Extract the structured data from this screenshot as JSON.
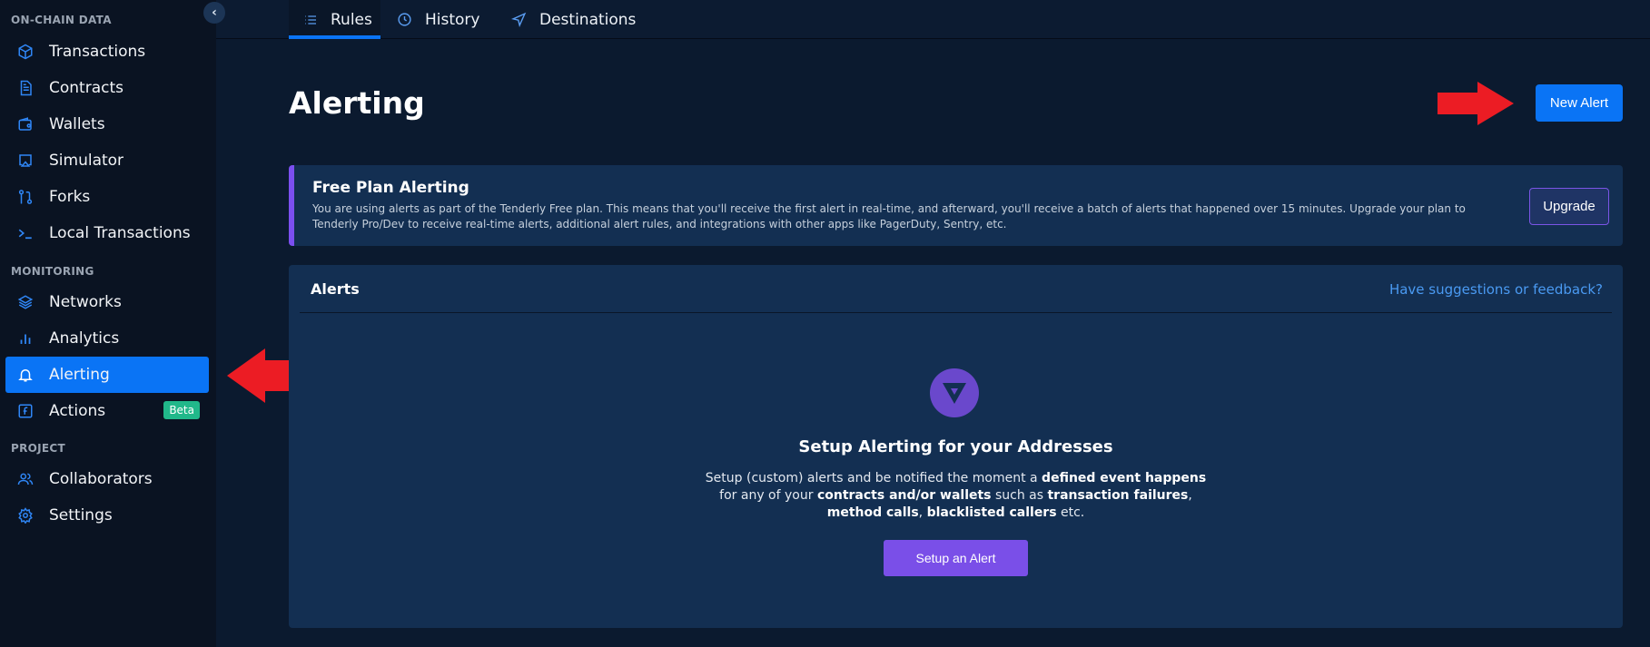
{
  "sidebar": {
    "collapse_icon": "chevron-left-icon",
    "sections": [
      {
        "label": "ON-CHAIN DATA",
        "items": [
          {
            "label": "Transactions",
            "icon": "cube-icon"
          },
          {
            "label": "Contracts",
            "icon": "document-icon"
          },
          {
            "label": "Wallets",
            "icon": "wallet-icon"
          },
          {
            "label": "Simulator",
            "icon": "monitor-icon"
          },
          {
            "label": "Forks",
            "icon": "git-fork-icon"
          },
          {
            "label": "Local Transactions",
            "icon": "terminal-icon"
          }
        ]
      },
      {
        "label": "MONITORING",
        "items": [
          {
            "label": "Networks",
            "icon": "layers-icon"
          },
          {
            "label": "Analytics",
            "icon": "bar-chart-icon"
          },
          {
            "label": "Alerting",
            "icon": "bell-icon",
            "active": true
          },
          {
            "label": "Actions",
            "icon": "function-icon",
            "badge": "Beta"
          }
        ]
      },
      {
        "label": "PROJECT",
        "items": [
          {
            "label": "Collaborators",
            "icon": "users-icon"
          },
          {
            "label": "Settings",
            "icon": "gear-icon"
          }
        ]
      }
    ]
  },
  "tabs": [
    {
      "label": "Rules",
      "icon": "list-icon",
      "active": true
    },
    {
      "label": "History",
      "icon": "clock-icon"
    },
    {
      "label": "Destinations",
      "icon": "send-icon"
    }
  ],
  "page": {
    "title": "Alerting",
    "new_alert_label": "New Alert"
  },
  "banner": {
    "title": "Free Plan Alerting",
    "text": "You are using alerts as part of the Tenderly Free plan. This means that you'll receive the first alert in real-time, and afterward, you'll receive a batch of alerts that happened over 15 minutes. Upgrade your plan to Tenderly Pro/Dev to receive real-time alerts, additional alert rules, and integrations with other apps like PagerDuty, Sentry, etc.",
    "upgrade_label": "Upgrade"
  },
  "alerts_panel": {
    "title": "Alerts",
    "feedback_link": "Have suggestions or feedback?",
    "empty_state": {
      "icon": "tenderly-logo-icon",
      "title": "Setup Alerting for your Addresses",
      "desc_parts": [
        {
          "text": "Setup (custom) alerts and be notified the moment a ",
          "bold": false
        },
        {
          "text": "defined event happens",
          "bold": true
        },
        {
          "text": " for any of your ",
          "bold": false
        },
        {
          "text": "contracts and/or wallets",
          "bold": true
        },
        {
          "text": " such as ",
          "bold": false
        },
        {
          "text": "transaction failures",
          "bold": true
        },
        {
          "text": ", ",
          "bold": false
        },
        {
          "text": "method calls",
          "bold": true
        },
        {
          "text": ", ",
          "bold": false
        },
        {
          "text": "blacklisted callers",
          "bold": true
        },
        {
          "text": " etc.",
          "bold": false
        }
      ],
      "button_label": "Setup an Alert"
    }
  },
  "annotations": {
    "arrow_color": "#ec1c24",
    "arrows": [
      "arrow-to-alerting-nav",
      "arrow-to-new-alert-button"
    ]
  },
  "colors": {
    "accent_blue": "#0a74f5",
    "accent_purple": "#7a4fe8",
    "badge_green": "#21b88a",
    "panel_bg": "#132f52",
    "page_bg": "#0b1a2f",
    "sidebar_bg": "#0a1322"
  }
}
